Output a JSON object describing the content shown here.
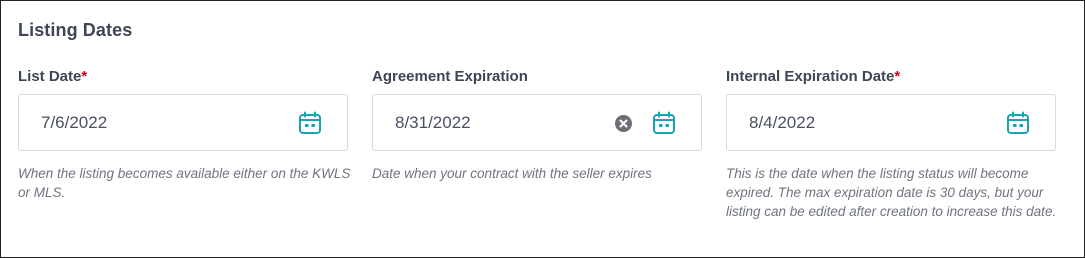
{
  "section": {
    "title": "Listing Dates"
  },
  "fields": [
    {
      "label": "List Date",
      "required_mark": "*",
      "value": "7/6/2022",
      "helper": "When the listing becomes available either on the KWLS or MLS."
    },
    {
      "label": "Agreement Expiration",
      "required_mark": "",
      "value": "8/31/2022",
      "helper": "Date when your contract with the seller expires"
    },
    {
      "label": "Internal Expiration Date",
      "required_mark": "*",
      "value": "8/4/2022",
      "helper": "This is the date when the listing status will become expired. The max expiration date is 30 days, but your listing can be edited after creation to increase this date."
    }
  ],
  "icons": {
    "calendar": "calendar-icon",
    "clear": "clear-icon"
  },
  "colors": {
    "accent": "#1aa3b5",
    "required": "#d0021b",
    "helper_text": "#6f7480",
    "border": "#d6d9de"
  }
}
